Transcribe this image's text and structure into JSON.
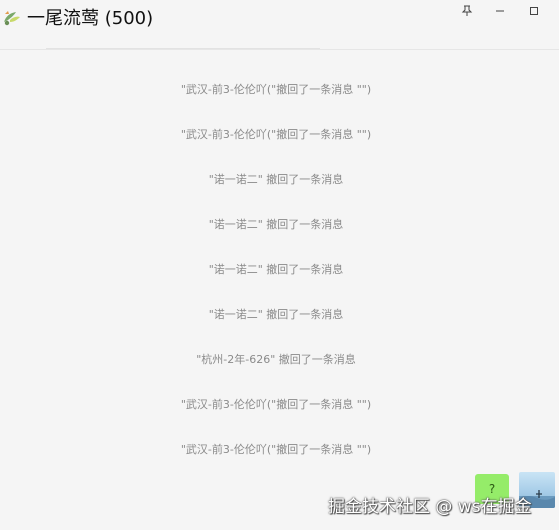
{
  "window": {
    "title": "一尾流莺 (500)",
    "pin_icon": "pin-icon",
    "minimize_icon": "minimize-icon",
    "maximize_icon": "maximize-icon"
  },
  "messages": [
    "\"武汉-前3-伦伦吖(\"撤回了一条消息 \"\")",
    "\"武汉-前3-伦伦吖(\"撤回了一条消息 \"\")",
    "\"诺一诺二\" 撤回了一条消息",
    "\"诺一诺二\" 撤回了一条消息",
    "\"诺一诺二\" 撤回了一条消息",
    "\"诺一诺二\" 撤回了一条消息",
    "\"杭州-2年-626\" 撤回了一条消息",
    "\"武汉-前3-伦伦吖(\"撤回了一条消息 \"\")",
    "\"武汉-前3-伦伦吖(\"撤回了一条消息 \"\")"
  ],
  "bubble": {
    "text": "?",
    "color": "#95ec69"
  },
  "watermark": "掘金技术社区 @ ws在掘金"
}
